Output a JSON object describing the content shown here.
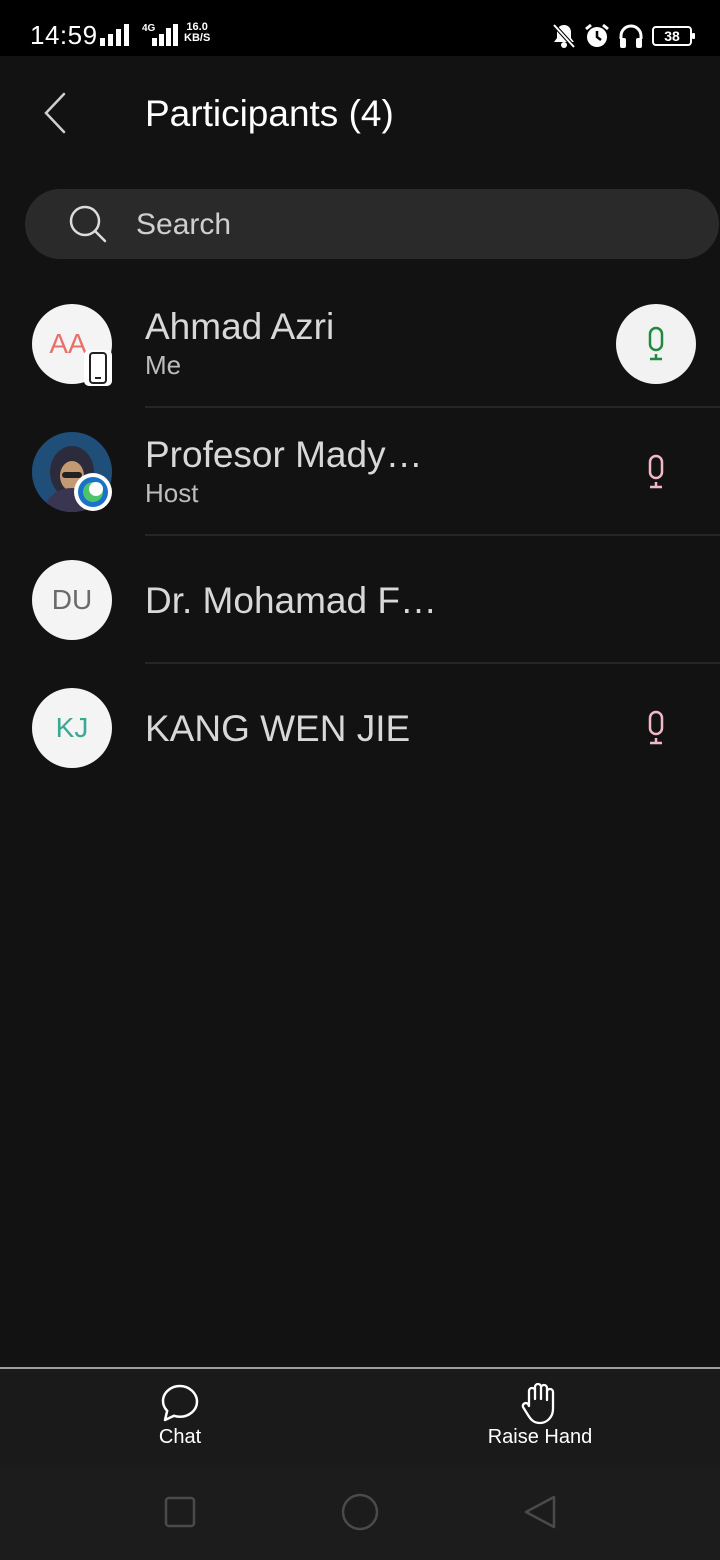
{
  "status_bar": {
    "time": "14:59",
    "network": "4G",
    "speed_value": "16.0",
    "speed_unit": "KB/S",
    "battery": "38"
  },
  "header": {
    "title": "Participants (4)"
  },
  "search": {
    "placeholder": "Search"
  },
  "participants": [
    {
      "initials": "AA",
      "name": "Ahmad Azri",
      "role": "Me",
      "initials_color": "#e8706a",
      "mic": "active"
    },
    {
      "initials": "",
      "name": "Profesor Mady…",
      "role": "Host",
      "mic": "muted"
    },
    {
      "initials": "DU",
      "name": "Dr. Mohamad F…",
      "role": "",
      "initials_color": "#6b6b6b",
      "mic": "none"
    },
    {
      "initials": "KJ",
      "name": "KANG WEN JIE",
      "role": "",
      "initials_color": "#3aa894",
      "mic": "muted"
    }
  ],
  "bottom_bar": {
    "chat_label": "Chat",
    "raise_hand_label": "Raise Hand"
  },
  "colors": {
    "mic_active": "#1e8a3c",
    "mic_muted": "#f2b8c6",
    "background": "#121212"
  }
}
